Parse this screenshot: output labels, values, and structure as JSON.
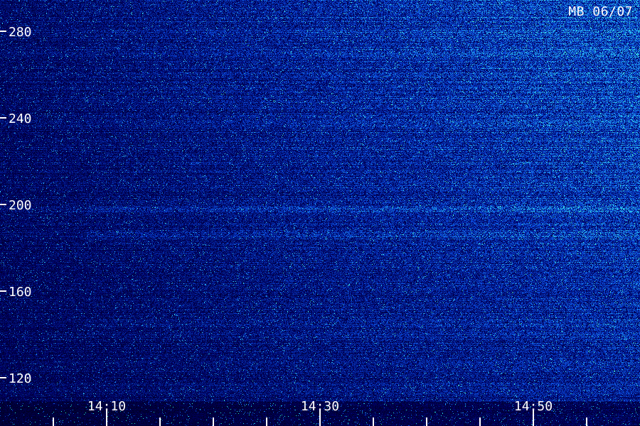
{
  "chart_data": {
    "type": "heatmap",
    "title": "MB 06/07",
    "xlabel": "",
    "ylabel": "",
    "y_ticks": [
      "280",
      "240",
      "200",
      "160",
      "120"
    ],
    "y_tick_values": [
      280,
      240,
      200,
      160,
      120
    ],
    "y_range": [
      111,
      296
    ],
    "x_tick_labels": [
      "14:10",
      "14:30",
      "14:50"
    ],
    "x_tick_minutes": [
      10,
      30,
      50
    ],
    "x_range_minutes": [
      0,
      60
    ],
    "x_minor_tick_interval_minutes": 5,
    "bands": [
      {
        "frequency": 198,
        "intensity": 0.35
      },
      {
        "frequency": 186,
        "intensity": 0.45
      },
      {
        "frequency": 145,
        "intensity": 0.25
      }
    ],
    "colors": {
      "background": "#000010",
      "low": "#0a0f6e",
      "mid": "#1a46c8",
      "high": "#2ee6c8",
      "ticks": "#ffffff"
    }
  }
}
